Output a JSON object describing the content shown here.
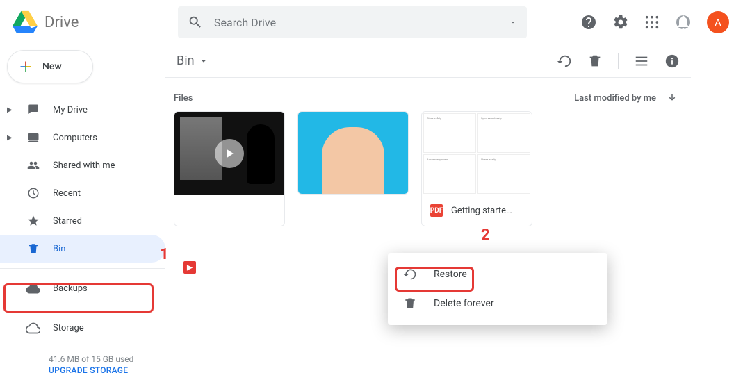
{
  "app_name": "Drive",
  "search": {
    "placeholder": "Search Drive"
  },
  "avatar_letter": "A",
  "new_button": "New",
  "sidebar": {
    "items": [
      {
        "label": "My Drive"
      },
      {
        "label": "Computers"
      },
      {
        "label": "Shared with me"
      },
      {
        "label": "Recent"
      },
      {
        "label": "Starred"
      },
      {
        "label": "Bin"
      },
      {
        "label": "Backups"
      }
    ],
    "storage_label": "Storage",
    "storage_used": "41.6 MB of 15 GB used",
    "upgrade": "UPGRADE STORAGE"
  },
  "breadcrumb": "Bin",
  "section_title": "Files",
  "sort_label": "Last modified by me",
  "files": [
    {
      "name": "",
      "kind": "video"
    },
    {
      "name": "",
      "kind": "image"
    },
    {
      "name": "Getting starte…",
      "kind": "pdf"
    }
  ],
  "pdf_cells": [
    "Store safely",
    "Sync seamlessly",
    "Access anywhere",
    "Share easily"
  ],
  "pdf_chip": "PDF",
  "context_menu": {
    "restore": "Restore",
    "delete": "Delete forever"
  },
  "annotations": {
    "one": "1",
    "two": "2"
  }
}
